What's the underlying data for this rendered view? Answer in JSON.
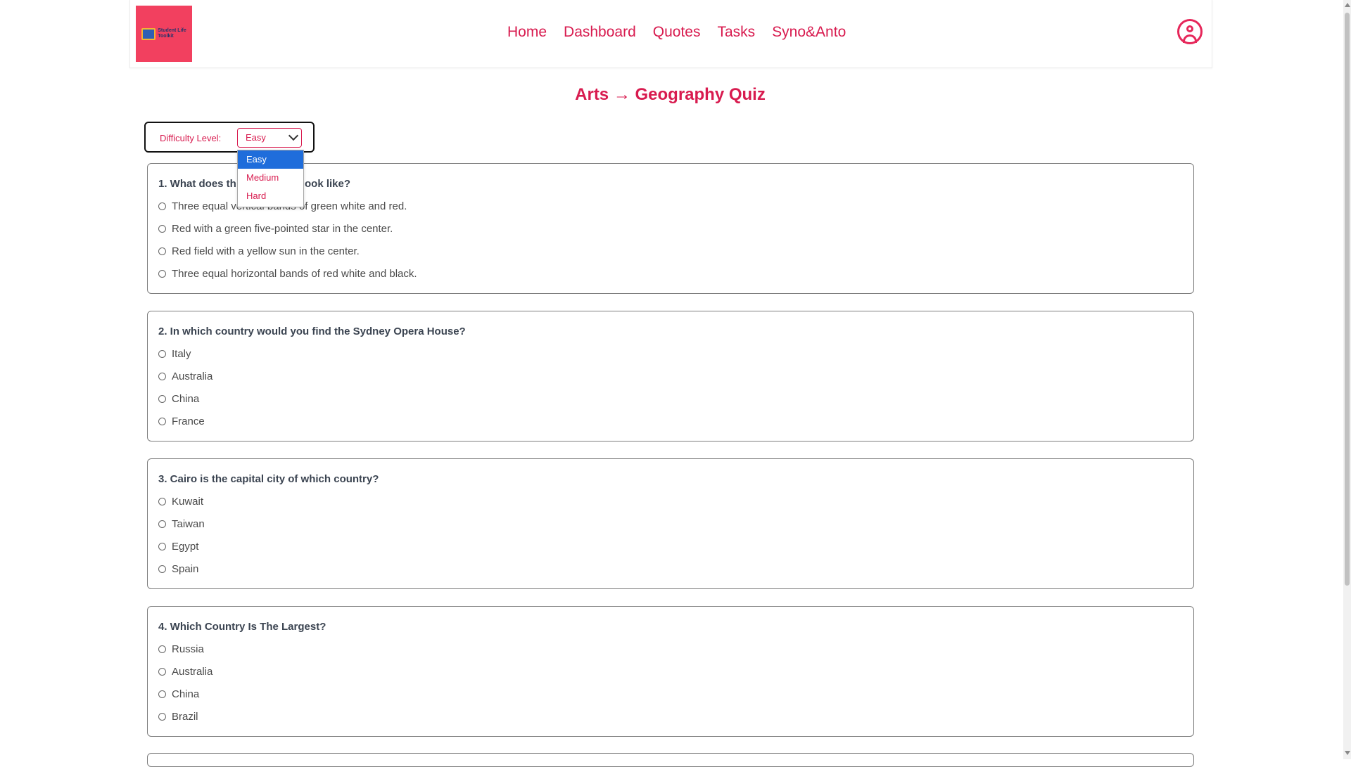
{
  "nav": {
    "logo_text_line1": "Student Life",
    "logo_text_line2": "Toolkit",
    "links": [
      "Home",
      "Dashboard",
      "Quotes",
      "Tasks",
      "Syno&Anto"
    ]
  },
  "quiz": {
    "title": "Arts → Geography Quiz",
    "difficulty_label": "Difficulty Level:",
    "difficulty_selected": "Easy",
    "difficulty_options": [
      "Easy",
      "Medium",
      "Hard"
    ],
    "questions": [
      {
        "text": "1. What does the flag of Italy look like?",
        "visible_text_prefix": "1. What does th",
        "visible_text_suffix": "look like?",
        "options": [
          "Three equal vertical bands of green white and red.",
          "Red with a green five-pointed star in the center.",
          "Red field with a yellow sun in the center.",
          "Three equal horizontal bands of red white and black."
        ]
      },
      {
        "text": "2. In which country would you find the Sydney Opera House?",
        "options": [
          "Italy",
          "Australia",
          "China",
          "France"
        ]
      },
      {
        "text": "3. Cairo is the capital city of which country?",
        "options": [
          "Kuwait",
          "Taiwan",
          "Egypt",
          "Spain"
        ]
      },
      {
        "text": "4. Which Country Is The Largest?",
        "options": [
          "Russia",
          "Australia",
          "China",
          "Brazil"
        ]
      }
    ]
  },
  "colors": {
    "accent": "#d81b4f",
    "logo_bg": "#f2405f",
    "selected_option_bg": "#1f6ddb"
  }
}
